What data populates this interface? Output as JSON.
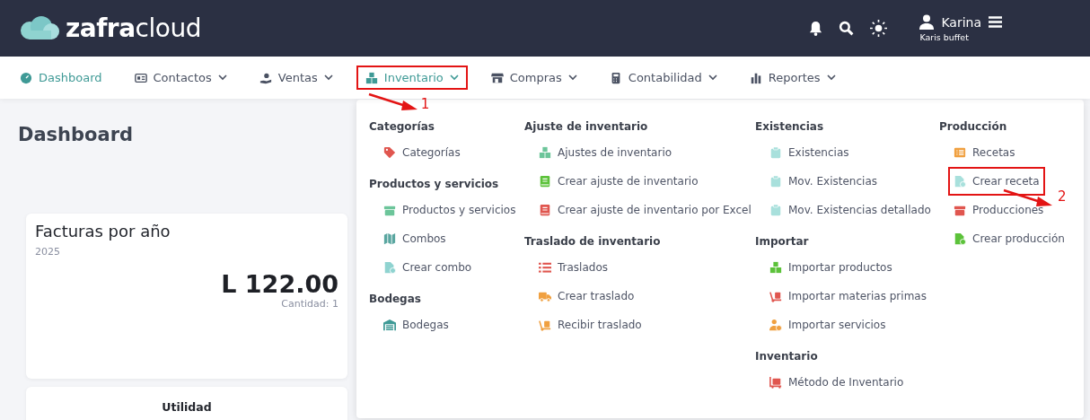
{
  "header": {
    "logo": {
      "bold": "zafra",
      "light": "cloud"
    },
    "user": {
      "name": "Karina",
      "company": "Karis buffet"
    }
  },
  "nav": [
    {
      "label": "Dashboard",
      "kind": "link",
      "selected": true
    },
    {
      "label": "Contactos",
      "kind": "dropdown",
      "selected": false
    },
    {
      "label": "Ventas",
      "kind": "dropdown",
      "selected": false
    },
    {
      "label": "Inventario",
      "kind": "dropdown",
      "selected": true,
      "annotation": "1"
    },
    {
      "label": "Compras",
      "kind": "dropdown",
      "selected": false
    },
    {
      "label": "Contabilidad",
      "kind": "dropdown",
      "selected": false
    },
    {
      "label": "Reportes",
      "kind": "dropdown",
      "selected": false
    }
  ],
  "mega_menu": {
    "columns": [
      {
        "sections": [
          {
            "title": "Categorías",
            "items": [
              {
                "label": "Categorías",
                "color": "#e0564f"
              }
            ]
          },
          {
            "title": "Productos y servicios",
            "items": [
              {
                "label": "Productos y servicios",
                "color": "#6cc59a"
              },
              {
                "label": "Combos",
                "color": "#5aa6a0"
              },
              {
                "label": "Crear combo",
                "color": "#8fd3d0"
              }
            ]
          },
          {
            "title": "Bodegas",
            "items": [
              {
                "label": "Bodegas",
                "color": "#3f9a96"
              }
            ]
          }
        ]
      },
      {
        "sections": [
          {
            "title": "Ajuste de inventario",
            "items": [
              {
                "label": "Ajustes de inventario",
                "color": "#6cc59a"
              },
              {
                "label": "Crear ajuste de inventario",
                "color": "#5cc23a"
              },
              {
                "label": "Crear ajuste de inventario por Excel",
                "color": "#e0564f"
              }
            ]
          },
          {
            "title": "Traslado de inventario",
            "items": [
              {
                "label": "Traslados",
                "color": "#e0564f"
              },
              {
                "label": "Crear traslado",
                "color": "#f0a040"
              },
              {
                "label": "Recibir traslado",
                "color": "#f0a040"
              }
            ]
          }
        ]
      },
      {
        "sections": [
          {
            "title": "Existencias",
            "items": [
              {
                "label": "Existencias",
                "color": "#a8e0dc"
              },
              {
                "label": "Mov. Existencias",
                "color": "#a8e0dc"
              },
              {
                "label": "Mov. Existencias detallado",
                "color": "#a8e0dc"
              }
            ]
          },
          {
            "title": "Importar",
            "items": [
              {
                "label": "Importar productos",
                "color": "#5cc23a"
              },
              {
                "label": "Importar materias primas",
                "color": "#e0564f"
              },
              {
                "label": "Importar servicios",
                "color": "#f0a040"
              }
            ]
          },
          {
            "title": "Inventario",
            "items": [
              {
                "label": "Método de Inventario",
                "color": "#e0564f"
              }
            ]
          }
        ]
      },
      {
        "sections": [
          {
            "title": "Producción",
            "items": [
              {
                "label": "Recetas",
                "color": "#f0a040"
              },
              {
                "label": "Crear receta",
                "color": "#a8e0dc",
                "annotation": "2"
              },
              {
                "label": "Producciones",
                "color": "#e0564f"
              },
              {
                "label": "Crear producción",
                "color": "#5cc23a"
              }
            ]
          }
        ]
      }
    ]
  },
  "page_title": "Dashboard",
  "cards": [
    {
      "kind": "stat",
      "title": "Facturas por año",
      "subtitle": "2025",
      "amount": "L 122.00",
      "caption": "Cantidad: 1"
    },
    {
      "kind": "heading",
      "title": "Utilidad"
    }
  ]
}
